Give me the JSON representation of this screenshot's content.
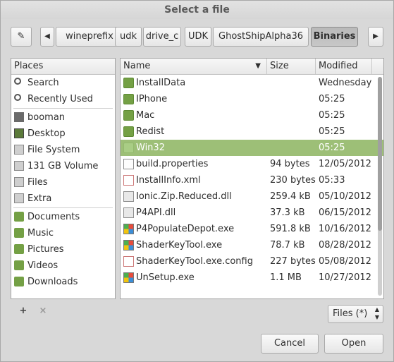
{
  "window": {
    "title": "Select a file"
  },
  "pathbar": {
    "edit_icon": "pencil-icon",
    "back_icon": "left-arrow-icon",
    "forward_icon": "right-arrow-icon",
    "segments": [
      "wineprefix",
      "udk",
      "drive_c",
      "UDK",
      "GhostShipAlpha36",
      "Binaries"
    ]
  },
  "places": {
    "header": "Places",
    "items": [
      {
        "label": "Search",
        "icon": "search-icon"
      },
      {
        "label": "Recently Used",
        "icon": "clock-icon"
      },
      {
        "label": "booman",
        "icon": "home-icon"
      },
      {
        "label": "Desktop",
        "icon": "desktop-icon"
      },
      {
        "label": "File System",
        "icon": "drive-icon"
      },
      {
        "label": "131 GB Volume",
        "icon": "drive-icon"
      },
      {
        "label": "Files",
        "icon": "drive-icon"
      },
      {
        "label": "Extra",
        "icon": "drive-icon"
      },
      {
        "label": "Documents",
        "icon": "folder-icon"
      },
      {
        "label": "Music",
        "icon": "music-folder-icon"
      },
      {
        "label": "Pictures",
        "icon": "pictures-folder-icon"
      },
      {
        "label": "Videos",
        "icon": "videos-folder-icon"
      },
      {
        "label": "Downloads",
        "icon": "downloads-folder-icon"
      }
    ]
  },
  "files": {
    "columns": {
      "name": "Name",
      "size": "Size",
      "modified": "Modified"
    },
    "rows": [
      {
        "name": "InstallData",
        "size": "",
        "modified": "Wednesday",
        "type": "folder"
      },
      {
        "name": "IPhone",
        "size": "",
        "modified": "05:25",
        "type": "folder"
      },
      {
        "name": "Mac",
        "size": "",
        "modified": "05:25",
        "type": "folder"
      },
      {
        "name": "Redist",
        "size": "",
        "modified": "05:25",
        "type": "folder"
      },
      {
        "name": "Win32",
        "size": "",
        "modified": "05:25",
        "type": "folder",
        "selected": true
      },
      {
        "name": "build.properties",
        "size": "94 bytes",
        "modified": "12/05/2012",
        "type": "doc"
      },
      {
        "name": "InstallInfo.xml",
        "size": "230 bytes",
        "modified": "05:33",
        "type": "xml"
      },
      {
        "name": "Ionic.Zip.Reduced.dll",
        "size": "259.4 kB",
        "modified": "05/10/2012",
        "type": "dll"
      },
      {
        "name": "P4API.dll",
        "size": "37.3 kB",
        "modified": "06/15/2012",
        "type": "dll"
      },
      {
        "name": "P4PopulateDepot.exe",
        "size": "591.8 kB",
        "modified": "10/16/2012",
        "type": "exe"
      },
      {
        "name": "ShaderKeyTool.exe",
        "size": "78.7 kB",
        "modified": "08/28/2012",
        "type": "exe"
      },
      {
        "name": "ShaderKeyTool.exe.config",
        "size": "227 bytes",
        "modified": "05/08/2012",
        "type": "xml"
      },
      {
        "name": "UnSetup.exe",
        "size": "1.1 MB",
        "modified": "10/27/2012",
        "type": "exe"
      }
    ]
  },
  "places_toolbar": {
    "add_label": "+",
    "remove_label": "×"
  },
  "filter": {
    "value": "Files (*)"
  },
  "buttons": {
    "cancel": "Cancel",
    "open": "Open"
  }
}
